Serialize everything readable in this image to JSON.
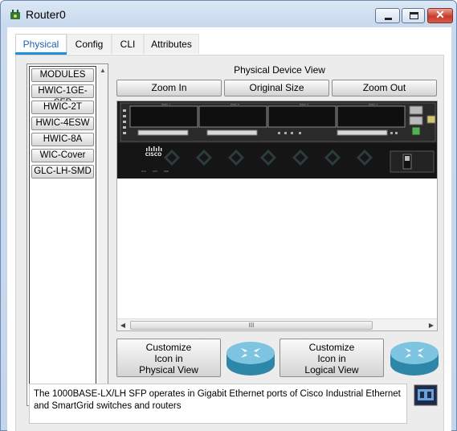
{
  "window": {
    "title": "Router0",
    "controls": {
      "close": "✕"
    }
  },
  "tabs": [
    {
      "label": "Physical",
      "active": true
    },
    {
      "label": "Config",
      "active": false
    },
    {
      "label": "CLI",
      "active": false
    },
    {
      "label": "Attributes",
      "active": false
    }
  ],
  "modules": {
    "items": [
      "MODULES",
      "HWIC-1GE-SFP",
      "HWIC-2T",
      "HWIC-4ESW",
      "HWIC-8A",
      "WIC-Cover",
      "GLC-LH-SMD"
    ]
  },
  "physical_view": {
    "label": "Physical Device View",
    "zoom_in": "Zoom In",
    "original_size": "Original Size",
    "zoom_out": "Zoom Out",
    "scrollbar_thumb": "III"
  },
  "device_image": {
    "brand": "CISCO",
    "slot_labels": [
      "HWIC 1",
      "HWIC 0",
      "HWIC 3",
      "HWIC 2"
    ],
    "status_leds": [
      "SYS",
      "ACT",
      "POE"
    ]
  },
  "customize": {
    "physical": [
      "Customize",
      "Icon in",
      "Physical View"
    ],
    "logical": [
      "Customize",
      "Icon in",
      "Logical View"
    ]
  },
  "info": {
    "text": "The 1000BASE-LX/LH SFP operates in Gigabit Ethernet ports of Cisco Industrial Ethernet and SmartGrid switches and routers"
  },
  "icons": {
    "app": "router-app-icon",
    "router": "router-icon",
    "sfp": "sfp-module-icon"
  },
  "colors": {
    "active_tab_underline": "#1e90e0",
    "active_tab_text": "#1f5fae",
    "router_icon": "#4aa6c8"
  }
}
